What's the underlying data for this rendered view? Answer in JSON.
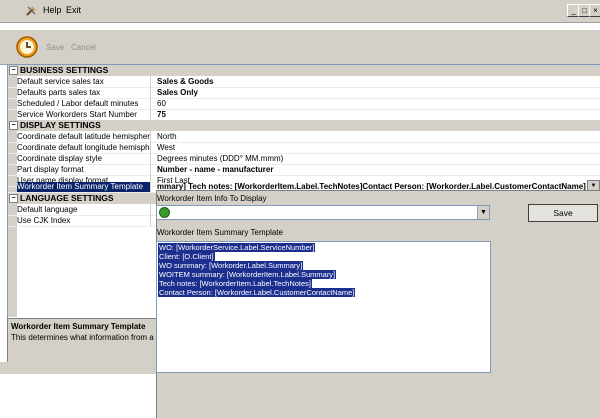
{
  "menu": {
    "help": "Help",
    "exit": "Exit"
  },
  "window_controls": {
    "minimize": "_",
    "maximize": "□",
    "close": "×"
  },
  "toolbar": {
    "save_label": "Save",
    "cancel_label": "Cancel"
  },
  "grid": {
    "business": {
      "title": "BUSINESS SETTINGS",
      "rows": [
        {
          "name": "Default service sales tax",
          "value": "Sales & Goods"
        },
        {
          "name": "Defaults parts sales tax",
          "value": "Sales Only"
        },
        {
          "name": "Scheduled / Labor default minutes",
          "value": "60"
        },
        {
          "name": "Service Workorders Start Number",
          "value": "75"
        }
      ]
    },
    "display": {
      "title": "DISPLAY SETTINGS",
      "rows": [
        {
          "name": "Coordinate default latitude hemisphere",
          "value": "North"
        },
        {
          "name": "Coordinate default longitude hemisphere",
          "value": "West"
        },
        {
          "name": "Coordinate display style",
          "value": "Degrees minutes (DDD° MM.mmm)"
        },
        {
          "name": "Part display format",
          "value": "Number - name - manufacturer"
        },
        {
          "name": "User name display format",
          "value": "First Last"
        },
        {
          "name": "Workorder Item Summary Template",
          "value": "mmary] Tech notes: [WorkorderItem.Label.TechNotes]Contact Person:  [Workorder.Label.CustomerContactName]"
        }
      ]
    },
    "language": {
      "title": "LANGUAGE SETTINGS",
      "rows": [
        {
          "name": "Default language",
          "value": ""
        },
        {
          "name": "Use CJK Index",
          "value": ""
        }
      ]
    }
  },
  "help_panel": {
    "title": "Workorder Item Summary Template",
    "description": "This determines what information from a ser"
  },
  "editor": {
    "info_label": "Workorder Item Info To Display",
    "save_label": "Save",
    "template_label": "Workorder Item Summary Template",
    "lines": [
      "WO: [WorkorderService.Label.ServiceNumber]",
      "Client:  [O.Client]",
      "WO summary: [Workorder.Label.Summary]",
      "WOITEM summary: [WorkorderItem.Label.Summary]",
      "Tech notes: [WorkorderItem.Label.TechNotes]",
      "Contact Person:  [Workorder.Label.CustomerContactName]"
    ]
  },
  "colors": {
    "selection": "#0a246a",
    "chrome": "#d4d0c8",
    "text_highlight": "#1c2f8f"
  }
}
